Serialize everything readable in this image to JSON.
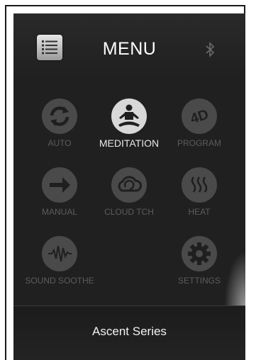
{
  "header": {
    "title": "MENU",
    "menu_icon": "list-menu-icon",
    "status_icon": "bluetooth-icon"
  },
  "tiles": [
    {
      "label": "AUTO",
      "icon": "refresh-icon",
      "active": false
    },
    {
      "label": "MEDITATION",
      "icon": "meditation-icon",
      "active": true
    },
    {
      "label": "PROGRAM",
      "icon": "4d-icon",
      "active": false
    },
    {
      "label": "MANUAL",
      "icon": "arrow-right-icon",
      "active": false
    },
    {
      "label": "CLOUD TCH",
      "icon": "cloud-touch-icon",
      "active": false
    },
    {
      "label": "HEAT",
      "icon": "heat-icon",
      "active": false
    },
    {
      "label": "SOUND SOOTHE",
      "icon": "sound-wave-icon",
      "active": false
    },
    {
      "label": "SETTINGS",
      "icon": "gear-icon",
      "active": false
    }
  ],
  "footer": {
    "title": "Ascent Series"
  },
  "colors": {
    "background": "#1e1e1e",
    "inactive_circle": "#4a4a4a",
    "active_circle": "#d8d8d8",
    "inactive_label": "#5c5c5c",
    "active_label": "#e8e8e8"
  },
  "icon_glyph": {
    "4d_text": "4D"
  }
}
